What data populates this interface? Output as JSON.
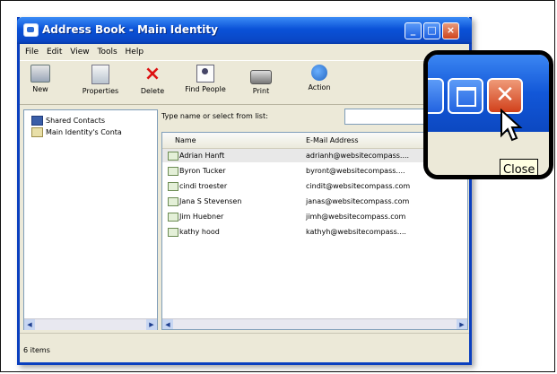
{
  "window": {
    "title": "Address Book - Main Identity",
    "buttons": {
      "minimize": "_",
      "maximize": "□",
      "close": "×"
    }
  },
  "menubar": [
    "File",
    "Edit",
    "View",
    "Tools",
    "Help"
  ],
  "toolbar": [
    {
      "label": "New",
      "icon": "new-contact-icon"
    },
    {
      "label": "Properties",
      "icon": "properties-icon"
    },
    {
      "label": "Delete",
      "icon": "delete-icon"
    },
    {
      "label": "Find People",
      "icon": "find-people-icon"
    },
    {
      "label": "Print",
      "icon": "print-icon"
    },
    {
      "label": "Action",
      "icon": "action-icon"
    }
  ],
  "sidebar": {
    "items": [
      {
        "label": "Shared Contacts",
        "icon": "folder-icon"
      },
      {
        "label": "Main Identity's Conta",
        "icon": "address-book-icon"
      }
    ]
  },
  "search": {
    "label": "Type name or select from list:",
    "value": ""
  },
  "list": {
    "columns": [
      "Name",
      "E-Mail Address"
    ],
    "rows": [
      {
        "name": "Adrian Hanft",
        "email": "adrianh@websitecompass....",
        "selected": true
      },
      {
        "name": "Byron Tucker",
        "email": "byront@websitecompass....",
        "selected": false
      },
      {
        "name": "cindi troester",
        "email": "cindit@websitecompass.com",
        "selected": false
      },
      {
        "name": "Jana S Stevensen",
        "email": "janas@websitecompass.com",
        "selected": false
      },
      {
        "name": "Jim Huebner",
        "email": "jimh@websitecompass.com",
        "selected": false
      },
      {
        "name": "kathy hood",
        "email": "kathyh@websitecompass....",
        "selected": false
      }
    ]
  },
  "statusbar": {
    "text": "6 items"
  },
  "zoom": {
    "tooltip": "Close"
  },
  "colors": {
    "titlebar": "#0a52d8",
    "close_button": "#d1401b",
    "window_bg": "#ece9d8"
  }
}
